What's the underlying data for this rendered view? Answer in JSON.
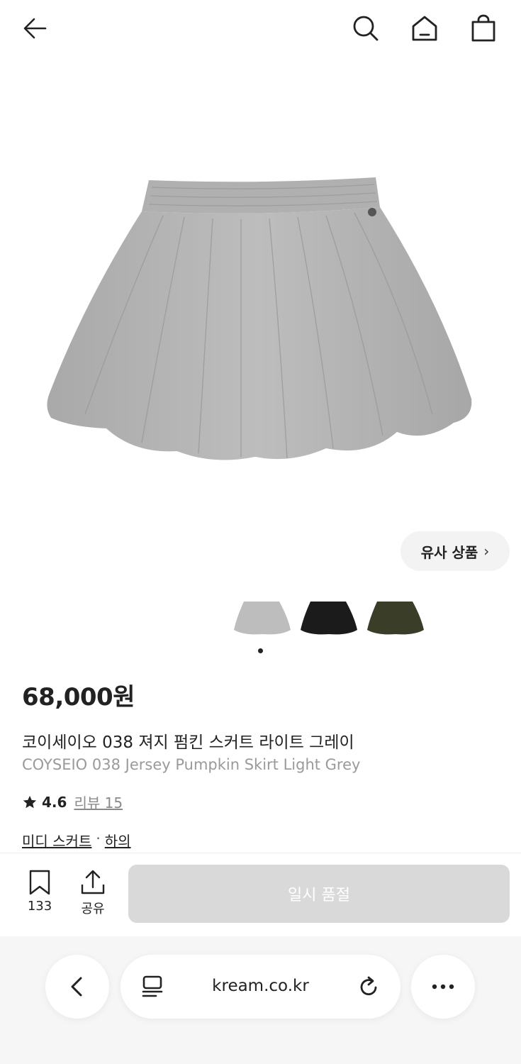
{
  "header": {
    "back_icon": "arrow-left-icon",
    "search_icon": "search-icon",
    "home_icon": "home-icon",
    "bag_icon": "shopping-bag-icon"
  },
  "gallery": {
    "similar_label": "유사 상품",
    "similar_icon": "chevron-right-icon",
    "thumbnails": [
      {
        "color": "#bdbdbd"
      },
      {
        "color": "#1b1b1b"
      },
      {
        "color": "#3a3d28"
      }
    ],
    "skirt_color": "#b3b3b3"
  },
  "product": {
    "price": "68,000원",
    "title_ko": "코이세이오 038 져지 펌킨 스커트 라이트 그레이",
    "title_en": "COYSEIO 038 Jersey Pumpkin Skirt Light Grey",
    "rating": "4.6",
    "review_label": "리뷰 15",
    "category_primary": "미디 스커트",
    "category_separator": "·",
    "category_secondary": "하의"
  },
  "actions": {
    "bookmark_count": "133",
    "share_label": "공유",
    "soldout_label": "일시 품절"
  },
  "browser": {
    "url": "kream.co.kr"
  }
}
